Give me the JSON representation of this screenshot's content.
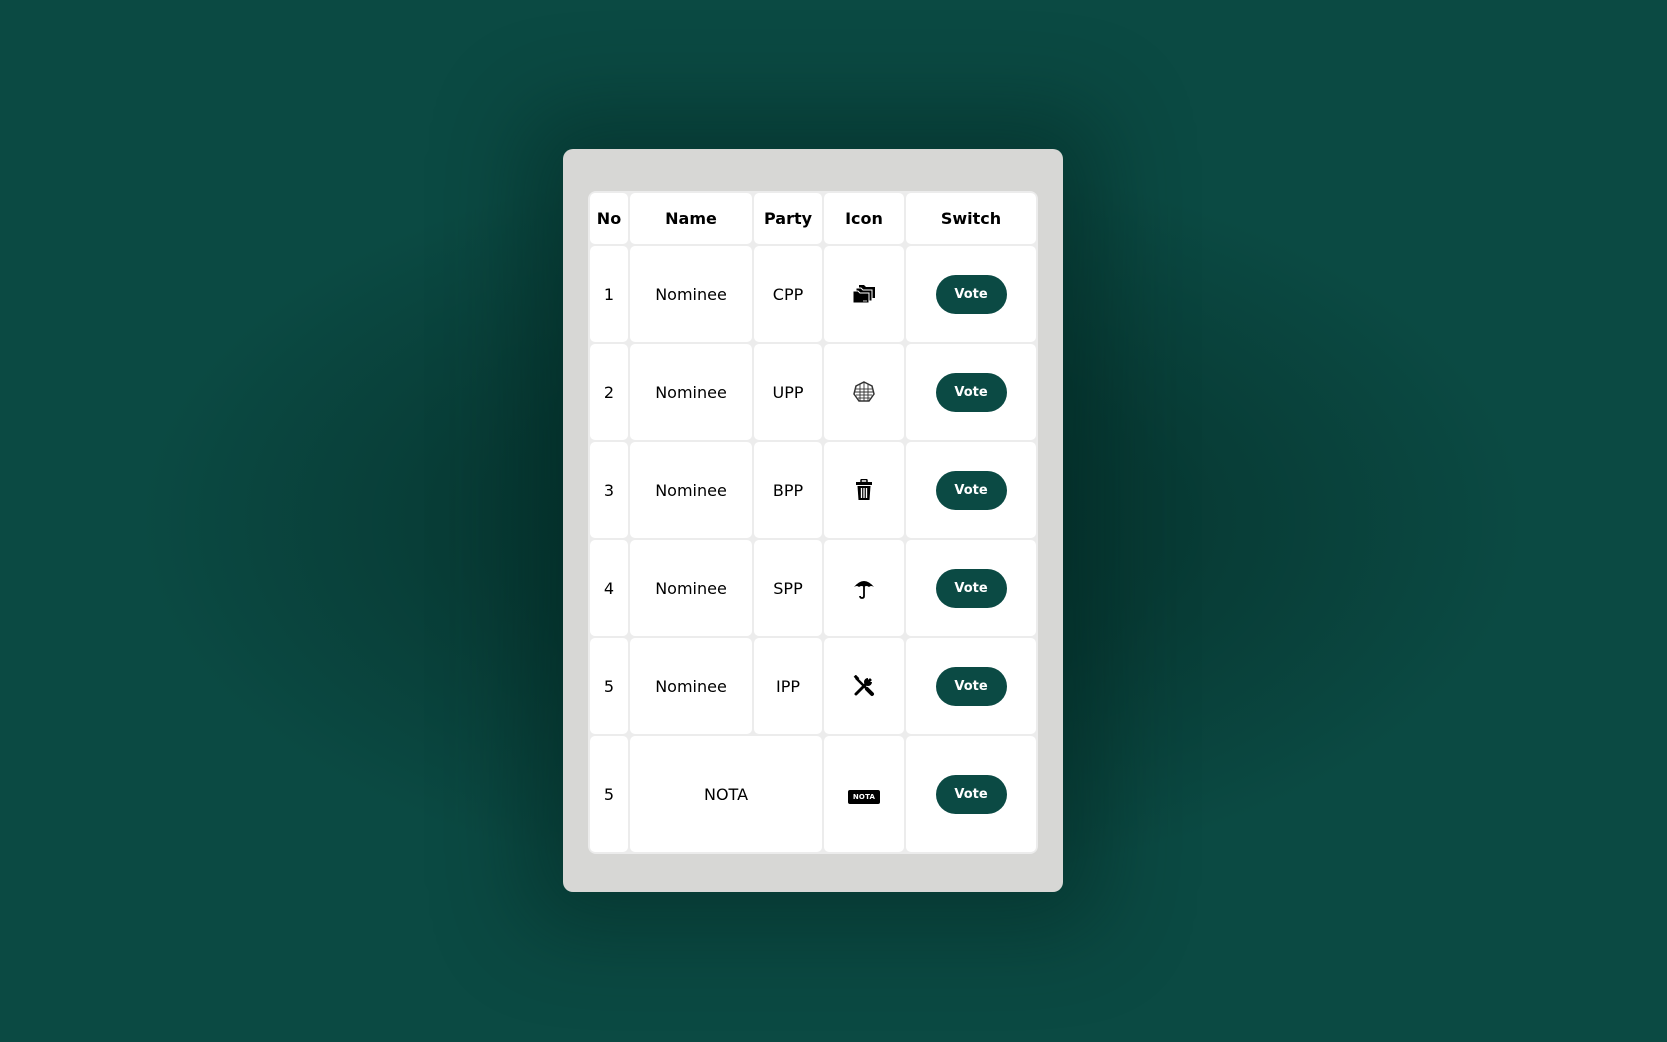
{
  "colors": {
    "background": "#0b4a43",
    "card": "#d7d7d5",
    "button": "#0b4a44"
  },
  "table": {
    "headers": {
      "no": "No",
      "name": "Name",
      "party": "Party",
      "icon": "Icon",
      "switch": "Switch"
    },
    "rows": [
      {
        "no": "1",
        "name": "Nominee",
        "party": "CPP",
        "icon": "folders-icon",
        "button": "Vote"
      },
      {
        "no": "2",
        "name": "Nominee",
        "party": "UPP",
        "icon": "web-globe-icon",
        "button": "Vote"
      },
      {
        "no": "3",
        "name": "Nominee",
        "party": "BPP",
        "icon": "trash-icon",
        "button": "Vote"
      },
      {
        "no": "4",
        "name": "Nominee",
        "party": "SPP",
        "icon": "umbrella-icon",
        "button": "Vote"
      },
      {
        "no": "5",
        "name": "Nominee",
        "party": "IPP",
        "icon": "tools-icon",
        "button": "Vote"
      }
    ],
    "nota": {
      "no": "5",
      "name": "NOTA",
      "icon": "nota-icon",
      "badge_text": "NOTA",
      "button": "Vote"
    }
  }
}
